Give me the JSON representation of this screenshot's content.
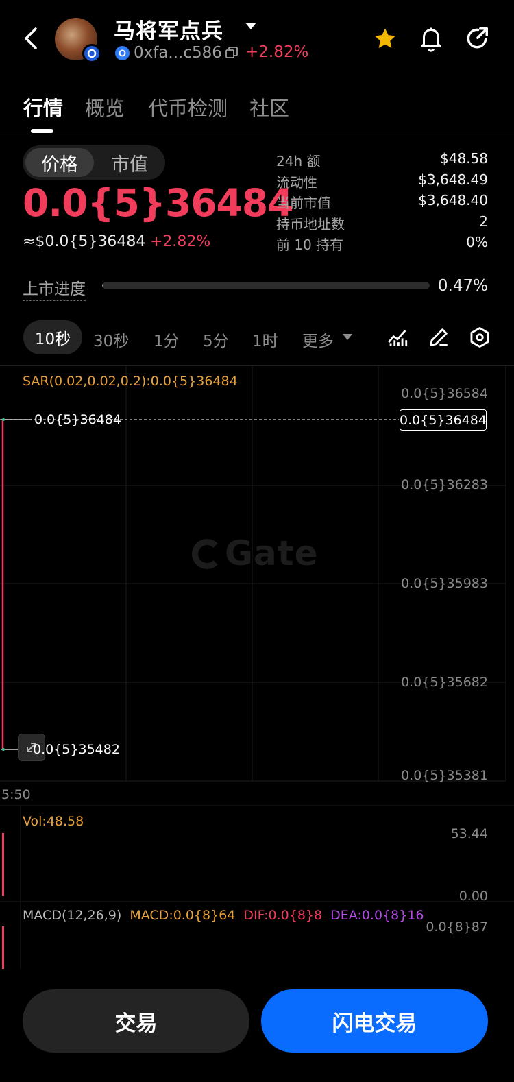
{
  "header": {
    "title": "马将军点兵",
    "address": "0xfa...c586",
    "change": "+2.82%"
  },
  "tabs": [
    {
      "label": "行情"
    },
    {
      "label": "概览"
    },
    {
      "label": "代币检测"
    },
    {
      "label": "社区"
    }
  ],
  "price_toggle": {
    "price": "价格",
    "market_cap": "市值"
  },
  "price": {
    "value": "0.0{5}36484",
    "approx": "≈$0.0{5}36484",
    "change": "+2.82%"
  },
  "stats": [
    {
      "label": "24h  额",
      "value": "$48.58"
    },
    {
      "label": "流动性",
      "value": "$3,648.49"
    },
    {
      "label": "当前市值",
      "value": "$3,648.40"
    },
    {
      "label": "持币地址数",
      "value": "2"
    },
    {
      "label": "前 10 持有",
      "value": "0%"
    }
  ],
  "listing_progress": {
    "label": "上市进度",
    "value": "0.47%",
    "fraction": 0.0047
  },
  "intervals": {
    "active": "10秒",
    "options": [
      "30秒",
      "1分",
      "5分",
      "1时"
    ],
    "more": "更多"
  },
  "chart": {
    "indicator": "SAR(0.02,0.02,0.2):0.0{5}36484",
    "current_price_tag": "0.0{5}36484",
    "high_label": "0.0{5}36484",
    "low_label": "0.0{5}35482",
    "watermark": "Gate",
    "time_label": "5:50",
    "y_ticks": [
      "0.0{5}36584",
      "0.0{5}36283",
      "0.0{5}35983",
      "0.0{5}35682",
      "0.0{5}35381"
    ],
    "volume": {
      "label": "Vol:48.58",
      "max": "53.44",
      "zero": "0.00"
    },
    "macd": {
      "params": "MACD(12,26,9)",
      "macd": "MACD:0.0{8}64",
      "dif": "DIF:0.0{8}8",
      "dea": "DEA:0.0{8}16",
      "max": "0.0{8}87"
    },
    "colors": {
      "up": "#f23c5b",
      "sar": "#e9a23b",
      "dif": "#f23c5b",
      "dea": "#b44be6",
      "grid": "#1e1e1e"
    }
  },
  "buttons": {
    "trade": "交易",
    "flash_trade": "闪电交易"
  },
  "colors": {
    "accent_red": "#f23c5b",
    "brand_blue": "#0a6cff",
    "star": "#f5b800"
  }
}
